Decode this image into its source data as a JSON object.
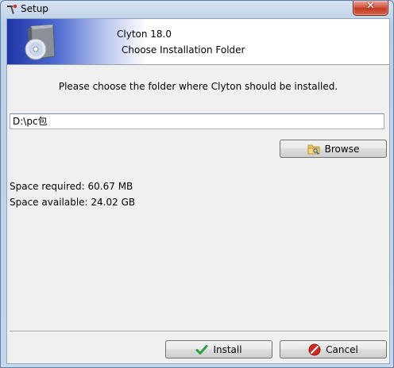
{
  "window": {
    "title": "Setup"
  },
  "header": {
    "title": "Clyton 18.0",
    "subtitle": "Choose Installation Folder"
  },
  "main": {
    "prompt": "Please choose the folder where Clyton should be installed.",
    "path_value": "D:\\pc包",
    "browse_label": "Browse",
    "space_required": "Space required: 60.67 MB",
    "space_available": "Space available: 24.02 GB"
  },
  "footer": {
    "install_label": "Install",
    "cancel_label": "Cancel"
  },
  "colors": {
    "accent": "#2036a8",
    "install_check": "#2ea043",
    "cancel_red": "#d8231b"
  },
  "icons": [
    "setup-app-icon",
    "close-icon",
    "cd-box-icon",
    "folder-icon",
    "checkmark-icon",
    "cancel-icon"
  ]
}
